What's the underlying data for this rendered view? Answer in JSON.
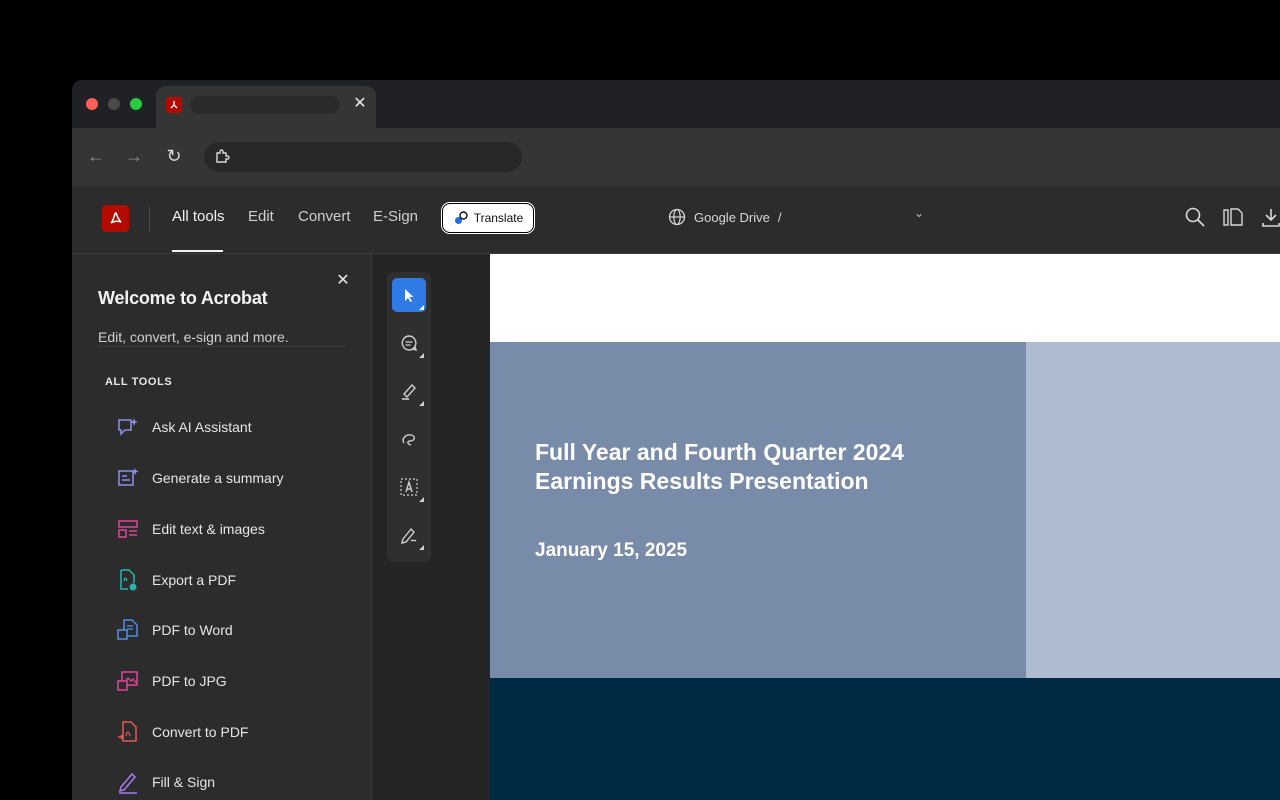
{
  "browser": {
    "tab_close": "✕",
    "nav": {
      "back": "←",
      "forward": "→",
      "reload": "↻"
    }
  },
  "appbar": {
    "nav": [
      "All tools",
      "Edit",
      "Convert",
      "E-Sign"
    ],
    "translate_label": "Translate",
    "location": "Google Drive",
    "location_separator": "/"
  },
  "panel": {
    "title": "Welcome to Acrobat",
    "subtitle": "Edit, convert, e-sign and more.",
    "close": "✕",
    "section_heading": "ALL TOOLS",
    "tools": [
      {
        "label": "Ask AI Assistant",
        "icon": "ai-assistant-icon",
        "color": "#8f8ff0"
      },
      {
        "label": "Generate a summary",
        "icon": "summary-icon",
        "color": "#8f8ff0"
      },
      {
        "label": "Edit text & images",
        "icon": "edit-text-icon",
        "color": "#e0459b"
      },
      {
        "label": "Export a PDF",
        "icon": "export-pdf-icon",
        "color": "#2bb3b0"
      },
      {
        "label": "PDF to Word",
        "icon": "pdf-to-word-icon",
        "color": "#4d8fe8"
      },
      {
        "label": "PDF to JPG",
        "icon": "pdf-to-jpg-icon",
        "color": "#e0459b"
      },
      {
        "label": "Convert to PDF",
        "icon": "convert-to-pdf-icon",
        "color": "#e05858"
      },
      {
        "label": "Fill & Sign",
        "icon": "fill-sign-icon",
        "color": "#a77cf0"
      }
    ]
  },
  "quick_tools": [
    "select-icon",
    "comment-icon",
    "highlight-icon",
    "draw-icon",
    "text-box-icon",
    "sign-icon"
  ],
  "document": {
    "title_line1": "Full Year and Fourth Quarter 2024",
    "title_line2": "Earnings Results Presentation",
    "date": "January 15, 2025"
  },
  "colors": {
    "accent": "#2f7ae5",
    "brand": "#b30b00",
    "slide_blue": "#788caa",
    "slide_light": "#aebbd0",
    "slide_navy": "#002a44"
  }
}
